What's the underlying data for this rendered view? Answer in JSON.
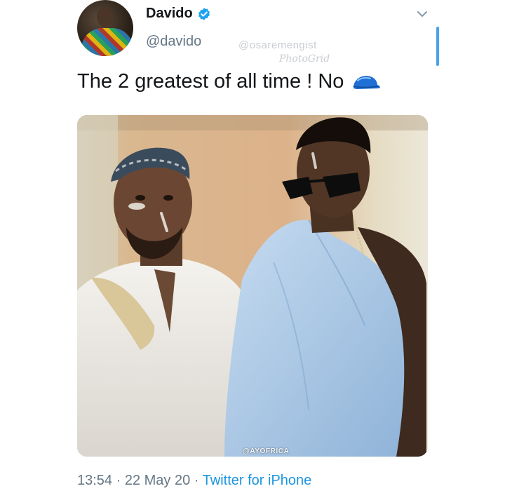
{
  "author": {
    "display_name": "Davido",
    "handle": "@davido",
    "verified": true,
    "avatar_icon": "avatar-photo"
  },
  "watermarks": {
    "line1": "@osaremengist",
    "line2": "PhotoGrid"
  },
  "tweet": {
    "text": "The 2 greatest of all time ! No",
    "emoji_icon": "blue-cap-icon"
  },
  "media": {
    "credit": "@AYOFRICA"
  },
  "meta": {
    "time": "13:54",
    "separator1": " · ",
    "date": "22 May 20",
    "separator2": " · ",
    "source": "Twitter for iPhone"
  },
  "colors": {
    "verified_blue": "#1da1f2",
    "link_blue": "#1b95e0",
    "muted_gray": "#657786",
    "text_dark": "#14171a"
  }
}
